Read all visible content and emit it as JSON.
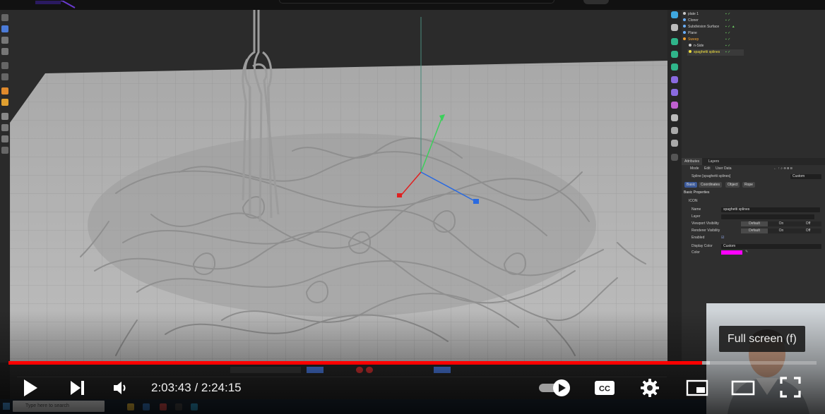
{
  "player": {
    "time_current": "2:03:43",
    "time_separator": " / ",
    "time_total": "2:24:15",
    "played_fraction": 0.858,
    "loaded_fraction": 0.868,
    "tooltip": "Full screen (f)",
    "autoplay_on": true,
    "colors": {
      "progress": "#ff0000",
      "background": "#000000",
      "text": "#eeeeee"
    },
    "icons": [
      "play-icon",
      "next-icon",
      "volume-icon",
      "autoplay-toggle-icon",
      "captions-icon",
      "settings-icon",
      "miniplayer-icon",
      "theater-icon",
      "fullscreen-icon"
    ]
  },
  "video": {
    "object_manager": {
      "items": [
        {
          "label": "plate 1",
          "color": "#c9c9c9"
        },
        {
          "label": "Cloner",
          "color": "#6ab0ff"
        },
        {
          "label": "Subdivision Surface",
          "color": "#6ab0ff"
        },
        {
          "label": "Plane",
          "color": "#6ab0ff"
        },
        {
          "label": "Sweep",
          "color": "#f0a030"
        },
        {
          "label": "n-Side",
          "color": "#c9c9c9"
        },
        {
          "label": "spaghetti splines",
          "color": "#f0e040"
        }
      ]
    },
    "attribute_manager": {
      "tabs": [
        "Attributes",
        "Layers"
      ],
      "menu": [
        "Mode",
        "Edit",
        "User Data"
      ],
      "object_title": "Spline [spaghetti splines]",
      "preset": "Custom",
      "sub_tabs": [
        "Basic",
        "Coordinates",
        "Object",
        "Rope"
      ],
      "section": "Basic Properties",
      "icon_label": "ICON",
      "fields": {
        "name_label": "Name",
        "name_value": "spaghetti splines",
        "layer_label": "Layer",
        "viewport_label": "Viewport Visibility",
        "render_label": "Renderer Visibility",
        "enabled_label": "Enabled",
        "display_color_label": "Display Color",
        "display_color_value": "Custom",
        "color_label": "Color"
      },
      "visibility_options": [
        "Default",
        "On",
        "Off"
      ],
      "swatch_color": "#ff00ff"
    },
    "taskbar": {
      "search_placeholder": "Type here to search"
    }
  }
}
